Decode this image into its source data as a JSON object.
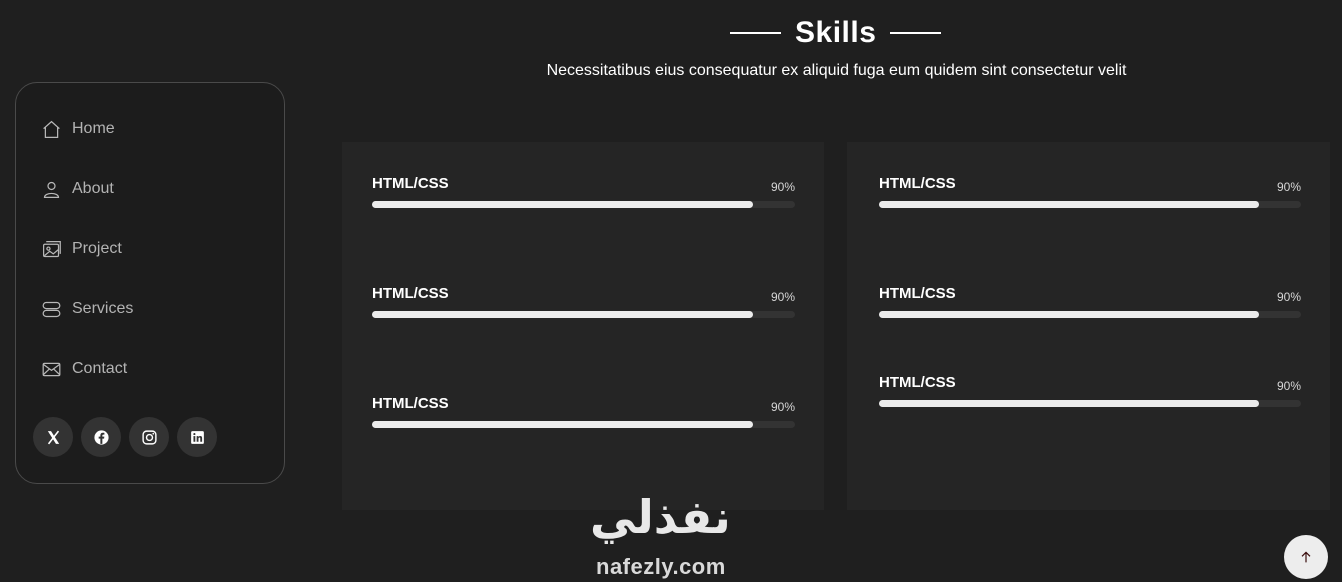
{
  "sidebar": {
    "items": [
      {
        "label": "Home",
        "icon": "house-icon"
      },
      {
        "label": "About",
        "icon": "person-icon"
      },
      {
        "label": "Project",
        "icon": "image-icon"
      },
      {
        "label": "Services",
        "icon": "server-icon"
      },
      {
        "label": "Contact",
        "icon": "envelope-icon"
      }
    ],
    "socials": [
      "x-twitter-icon",
      "facebook-icon",
      "instagram-icon",
      "linkedin-icon"
    ]
  },
  "section": {
    "title": "Skills",
    "subtitle": "Necessitatibus eius consequatur ex aliquid fuga eum quidem sint consectetur velit"
  },
  "skills_left": [
    {
      "name": "HTML/CSS",
      "percent_label": "90%",
      "value": 90
    },
    {
      "name": "HTML/CSS",
      "percent_label": "90%",
      "value": 90
    },
    {
      "name": "HTML/CSS",
      "percent_label": "90%",
      "value": 90
    }
  ],
  "skills_right": [
    {
      "name": "HTML/CSS",
      "percent_label": "90%",
      "value": 90
    },
    {
      "name": "HTML/CSS",
      "percent_label": "90%",
      "value": 90
    },
    {
      "name": "HTML/CSS",
      "percent_label": "90%",
      "value": 90
    }
  ],
  "watermark": {
    "arabic": "نفذلي",
    "latin": "nafezly.com"
  },
  "colors": {
    "background": "#1f1f1f",
    "card": "#252525",
    "bar_fill": "#ececec",
    "bar_track": "#333333"
  },
  "scroll_top_icon": "arrow-up-icon"
}
